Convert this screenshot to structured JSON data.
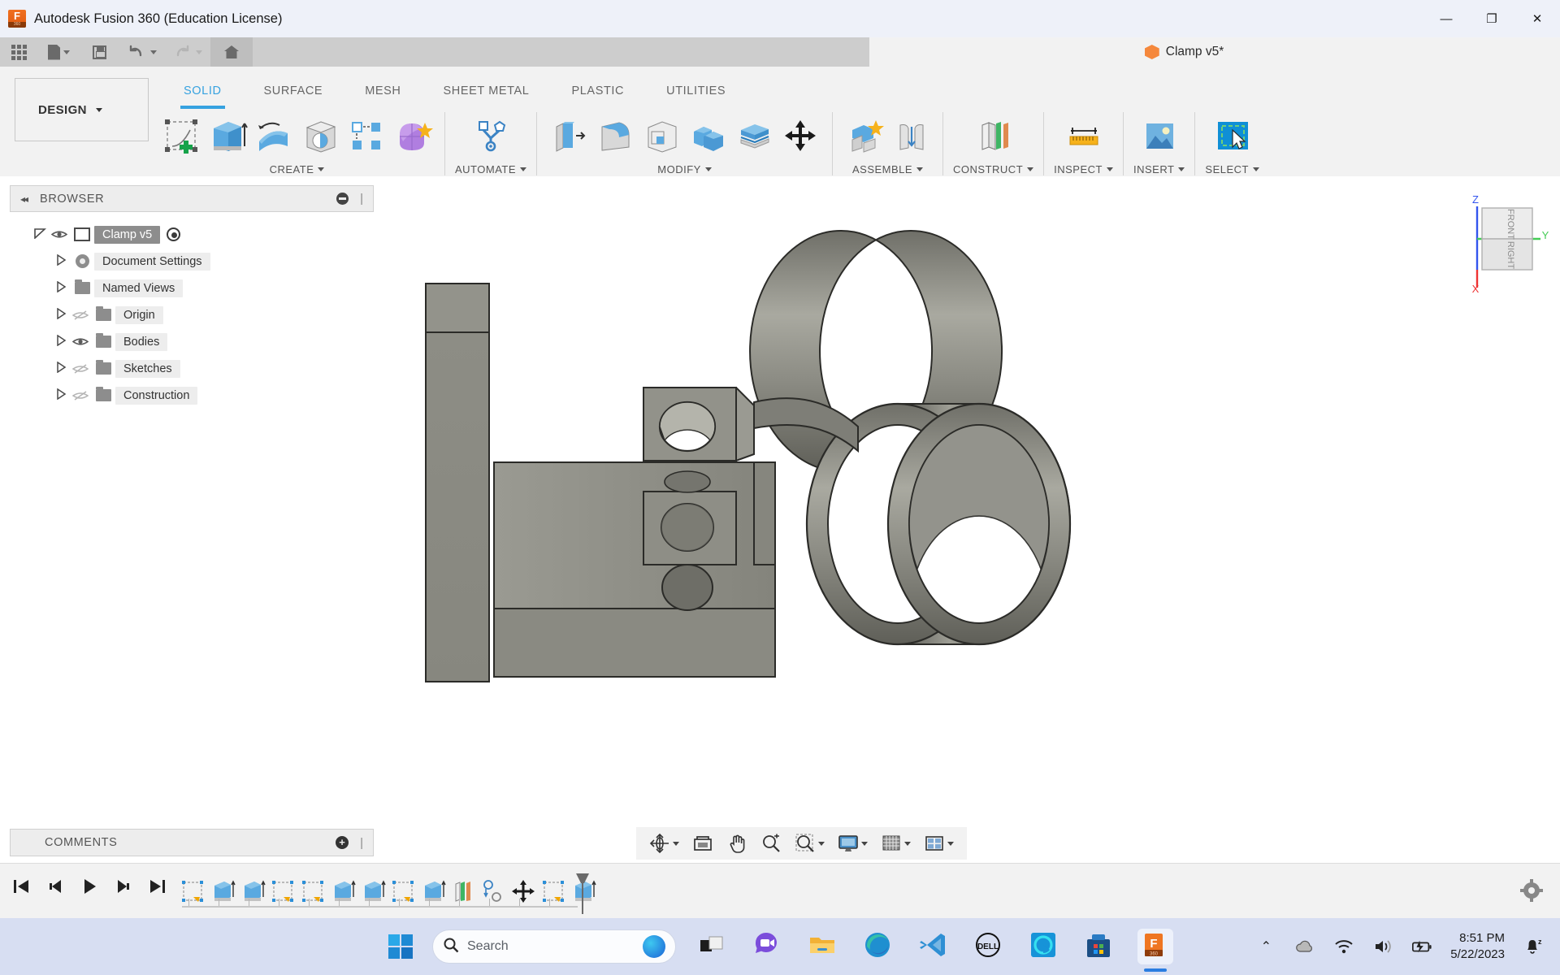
{
  "window": {
    "title": "Autodesk Fusion 360 (Education License)",
    "app_icon": "fusion360-icon",
    "minimize": "—",
    "maximize": "❐",
    "close": "✕"
  },
  "quick_access": {
    "items": [
      {
        "name": "app-grid-button",
        "label": ""
      },
      {
        "name": "new-document-button",
        "label": ""
      },
      {
        "name": "save-button",
        "label": ""
      },
      {
        "name": "undo-button",
        "label": ""
      },
      {
        "name": "redo-button",
        "label": ""
      },
      {
        "name": "home-button",
        "label": ""
      }
    ]
  },
  "document_tab": {
    "title": "Clamp v5*",
    "close_label": "✕",
    "new_tab_label": "+"
  },
  "ribbon": {
    "design_label": "DESIGN",
    "tabs": [
      {
        "label": "SOLID",
        "active": true
      },
      {
        "label": "SURFACE",
        "active": false
      },
      {
        "label": "MESH",
        "active": false
      },
      {
        "label": "SHEET METAL",
        "active": false
      },
      {
        "label": "PLASTIC",
        "active": false
      },
      {
        "label": "UTILITIES",
        "active": false
      }
    ],
    "panels": [
      {
        "title": "CREATE",
        "has_dropdown": true,
        "tools": [
          "create-sketch-icon",
          "extrude-icon",
          "revolve-icon",
          "hole-icon",
          "rectangular-pattern-icon",
          "form-icon"
        ]
      },
      {
        "title": "AUTOMATE",
        "has_dropdown": true,
        "tools": [
          "automated-modeling-icon"
        ]
      },
      {
        "title": "MODIFY",
        "has_dropdown": true,
        "tools": [
          "press-pull-icon",
          "fillet-icon",
          "shell-icon",
          "combine-icon",
          "split-face-icon",
          "move-copy-icon"
        ]
      },
      {
        "title": "ASSEMBLE",
        "has_dropdown": true,
        "tools": [
          "new-component-icon",
          "joint-icon"
        ]
      },
      {
        "title": "CONSTRUCT",
        "has_dropdown": true,
        "tools": [
          "offset-plane-icon"
        ]
      },
      {
        "title": "INSPECT",
        "has_dropdown": true,
        "tools": [
          "measure-icon"
        ]
      },
      {
        "title": "INSERT",
        "has_dropdown": true,
        "tools": [
          "insert-mcmaster-icon"
        ]
      },
      {
        "title": "SELECT",
        "has_dropdown": true,
        "tools": [
          "select-window-icon"
        ]
      }
    ]
  },
  "browser": {
    "header": "BROWSER",
    "collapse_label": "◂◂",
    "root": {
      "label": "Clamp v5",
      "visible": true,
      "expanded": true
    },
    "items": [
      {
        "label": "Document Settings",
        "icon": "gear-icon",
        "eye": "none",
        "expanded": false
      },
      {
        "label": "Named Views",
        "icon": "folder-icon",
        "eye": "none",
        "expanded": false
      },
      {
        "label": "Origin",
        "icon": "folder-icon",
        "eye": "hidden",
        "expanded": false
      },
      {
        "label": "Bodies",
        "icon": "folder-icon",
        "eye": "visible",
        "expanded": false
      },
      {
        "label": "Sketches",
        "icon": "folder-icon",
        "eye": "hidden",
        "expanded": false
      },
      {
        "label": "Construction",
        "icon": "folder-icon",
        "eye": "hidden",
        "expanded": false
      }
    ]
  },
  "comments": {
    "header": "COMMENTS",
    "add_label": "+"
  },
  "viewcube": {
    "front_face": "FRONT",
    "right_face": "RIGHT",
    "axis_z": "Z",
    "axis_y": "Y",
    "axis_x": "X",
    "colors": {
      "z": "#3355ee",
      "y": "#44cc55",
      "x": "#ee3333"
    }
  },
  "canvas": {
    "model_name": "clamp-3d-model",
    "background": "#ffffff",
    "material_color": "#8b8b84"
  },
  "navigation_bar": {
    "tools": [
      {
        "name": "orbit-icon",
        "dropdown": true
      },
      {
        "name": "look-at-icon",
        "dropdown": false
      },
      {
        "name": "pan-icon",
        "dropdown": false
      },
      {
        "name": "zoom-icon",
        "dropdown": false
      },
      {
        "name": "zoom-window-icon",
        "dropdown": true
      },
      {
        "name": "display-settings-icon",
        "dropdown": true
      },
      {
        "name": "grid-snaps-icon",
        "dropdown": true
      },
      {
        "name": "viewports-icon",
        "dropdown": true
      }
    ]
  },
  "timeline": {
    "playback": [
      "skip-to-start-icon",
      "step-back-icon",
      "play-icon",
      "step-forward-icon",
      "skip-to-end-icon"
    ],
    "features": [
      "sketch-feature-icon",
      "extrude-feature-icon",
      "extrude-feature-icon",
      "sketch-feature-icon",
      "sketch-feature-icon",
      "extrude-feature-icon",
      "extrude-feature-icon",
      "sketch-feature-icon",
      "extrude-feature-icon",
      "plane-feature-icon",
      "mirror-feature-icon",
      "move-feature-icon",
      "sketch-feature-icon",
      "extrude-feature-icon"
    ],
    "settings_icon": "gear-icon"
  },
  "taskbar": {
    "start_label": "start-button",
    "search_placeholder": "Search",
    "apps": [
      {
        "name": "task-view-button",
        "active": false
      },
      {
        "name": "teams-chat-icon",
        "active": false
      },
      {
        "name": "file-explorer-icon",
        "active": false
      },
      {
        "name": "microsoft-edge-icon",
        "active": false
      },
      {
        "name": "vscode-icon",
        "active": false
      },
      {
        "name": "dell-icon",
        "active": false
      },
      {
        "name": "alexa-icon",
        "active": false
      },
      {
        "name": "microsoft-store-icon",
        "active": false
      },
      {
        "name": "fusion360-taskbar-icon",
        "active": true
      }
    ],
    "tray": {
      "overflow": "⌃",
      "icons": [
        "onedrive-cloud-icon",
        "wifi-icon",
        "volume-icon",
        "battery-icon"
      ],
      "time": "8:51 PM",
      "date": "5/22/2023",
      "notifications_icon": "notifications-bell-icon"
    }
  }
}
